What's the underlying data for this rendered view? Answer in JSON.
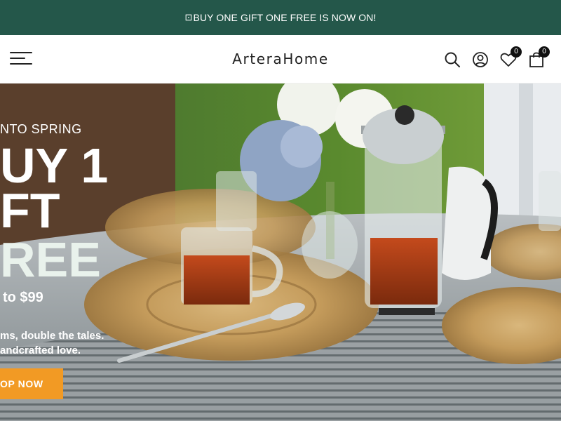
{
  "announcement": {
    "glyph": "⊡",
    "text": "BUY ONE GIFT ONE FREE IS NOW ON!"
  },
  "header": {
    "logo": "ArteraHome",
    "wishlist_count": "0",
    "cart_count": "0",
    "icons": [
      "menu-icon",
      "search-icon",
      "account-icon",
      "heart-icon",
      "shopping-bag-icon"
    ]
  },
  "hero": {
    "eyebrow": "NTO SPRING",
    "line1": "UY 1",
    "line2": "FT",
    "line3": "REE",
    "price": "to $99",
    "sub1": "ms, double the tales.",
    "sub2": "andcrafted love.",
    "cta": "OP NOW"
  },
  "colors": {
    "announcement_bg": "#24574a",
    "cta_bg": "#f29a24",
    "text_dark": "#222222"
  }
}
